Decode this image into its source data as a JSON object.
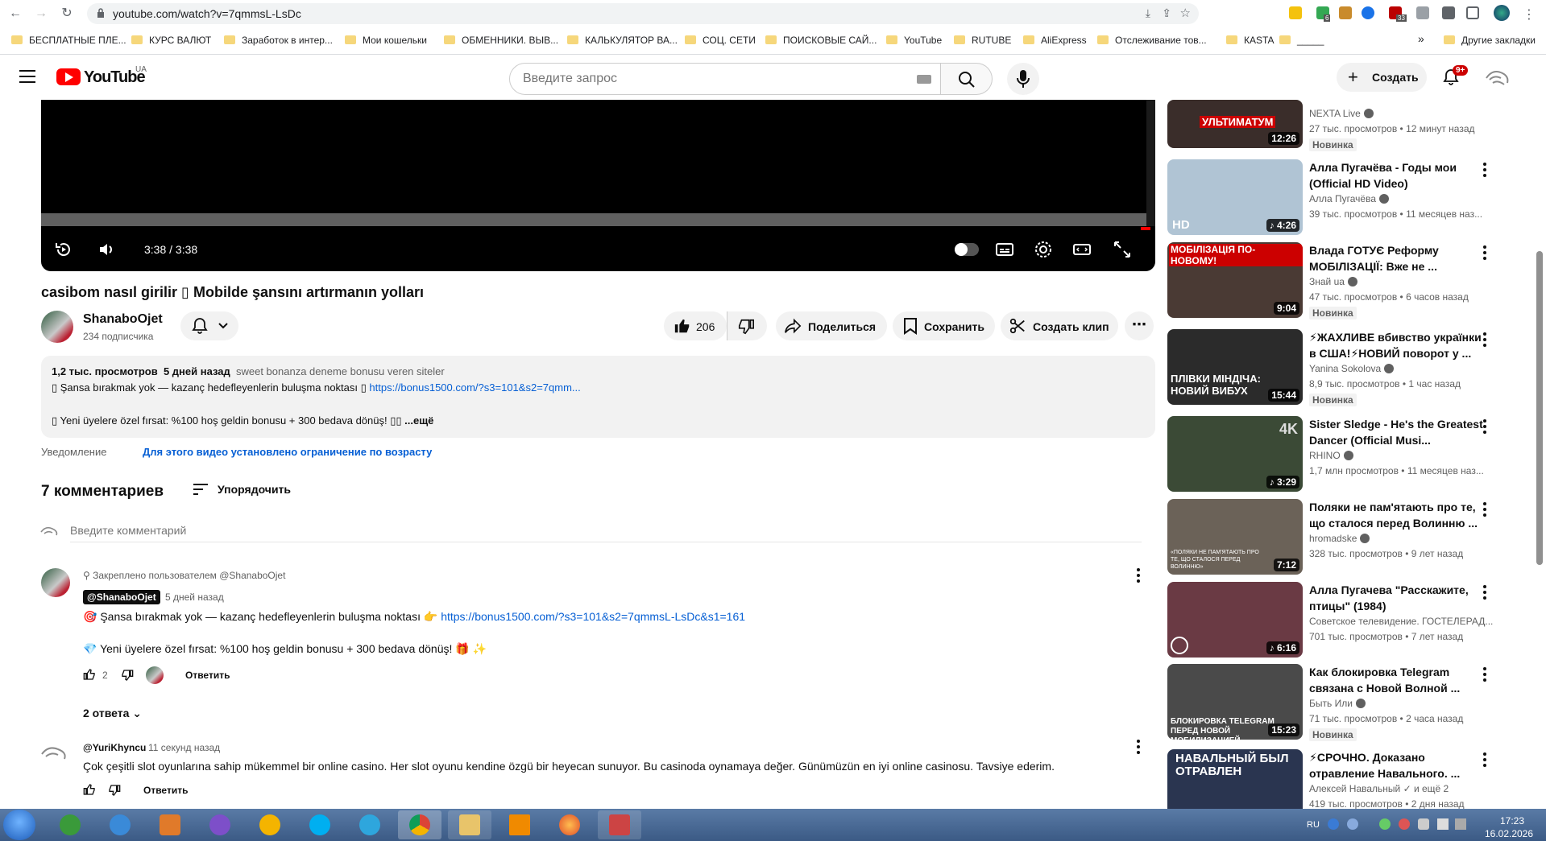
{
  "browser": {
    "url": "youtube.com/watch?v=7qmmsL-LsDc",
    "bookmarks": [
      "БЕСПЛАТНЫЕ ПЛЕ...",
      "КУРС ВАЛЮТ",
      "Заработок в интер...",
      "Мои кошельки",
      "ОБМЕННИКИ. ВЫВ...",
      "КАЛЬКУЛЯТОР ВА...",
      "СОЦ. СЕТИ",
      "ПОИСКОВЫЕ САЙ...",
      "YouTube",
      "RUTUBE",
      "AliExpress",
      "Отслеживание тов...",
      "КАSTA",
      "_____"
    ],
    "more_bookmarks": "»",
    "other_bookmarks": "Другие закладки",
    "ext_badge_1": "6",
    "ext_badge_2": "33"
  },
  "header": {
    "logo_text": "YouTube",
    "country": "UA",
    "search_placeholder": "Введите запрос",
    "create_label": "Создать",
    "notif_count": "9+"
  },
  "player": {
    "time": "3:38 / 3:38",
    "progress": 0.992
  },
  "video": {
    "title": "casibom nasıl girilir ▯ Mobilde şansını artırmanın yolları",
    "channel": "ShanaboOjet",
    "subscribers": "234 подписчика",
    "likes": "206",
    "share": "Поделиться",
    "save": "Сохранить",
    "clip": "Создать клип"
  },
  "description": {
    "views": "1,2 тыс. просмотров",
    "date": "5 дней назад",
    "tag": "sweet bonanza deneme bonusu veren siteler",
    "line1_text": "▯ Şansa bırakmak yok — kazanç hedefleyenlerin buluşma noktası ▯ ",
    "line1_link": "https://bonus1500.com/?s3=101&s2=7qmm...",
    "line2_text": "▯ Yeni üyelere özel fırsat: %100 hoş geldin bonusu + 300 bedava dönüş! ▯▯ ",
    "more": "...ещё"
  },
  "notice": {
    "label": "Уведомление",
    "text": "Для этого видео установлено ограничение по возрасту"
  },
  "comments": {
    "count": "7 комментариев",
    "sort": "Упорядочить",
    "placeholder": "Введите комментарий",
    "items": [
      {
        "pinned": "Закреплено пользователем @ShanaboOjet",
        "author": "@ShanaboOjet",
        "time": "5 дней назад",
        "text1": "🎯 Şansa bırakmak yok — kazanç hedefleyenlerin buluşma noktası 👉 ",
        "link": "https://bonus1500.com/?s3=101&s2=7qmmsL-LsDc&s1=161",
        "text2": "💎 Yeni üyelere özel fırsat: %100 hoş geldin bonusu + 300 bedava dönüş! 🎁 ✨",
        "likes": "2",
        "reply": "Ответить",
        "replies": "2 ответа"
      },
      {
        "author": "@YuriKhyncu",
        "time": "11 секунд назад",
        "text": "Çok çeşitli slot oyunlarına sahip mükemmel bir online casino. Her slot oyunu kendine özgü bir heyecan sunuyor. Bu casinoda oynamaya değer. Günümüzün en iyi online casinosu. Tavsiye ederim.",
        "reply": "Ответить"
      }
    ]
  },
  "sidebar": [
    {
      "title": "",
      "channel": "NEXTA Live",
      "meta": "27 тыс. просмотров • 12 минут назад",
      "badge": "Новинка",
      "duration": "12:26",
      "thumb_text": "УЛЬТИМАТУМ",
      "color": "#3a2d2a"
    },
    {
      "title": "Алла Пугачёва - Годы мои (Official HD Video)",
      "channel": "Алла Пугачёва",
      "meta": "39 тыс. просмотров • 11 месяцев наз...",
      "badge": "",
      "duration": "♪ 4:26",
      "thumb_text": "HD",
      "color": "#b0c4d4"
    },
    {
      "title": "Влада ГОТУЄ Реформу МОБІЛІЗАЦІЇ: Вже не ...",
      "channel": "Знай ua",
      "meta": "47 тыс. просмотров • 6 часов назад",
      "badge": "Новинка",
      "duration": "9:04",
      "thumb_text": "МОБІЛІЗАЦІЯ ПО-НОВОМУ!",
      "color": "#4a3a34"
    },
    {
      "title": "⚡ЖАХЛИВЕ вбивство українки в США!⚡НОВИЙ поворот у ...",
      "channel": "Yanina Sokolova",
      "meta": "8,9 тыс. просмотров • 1 час назад",
      "badge": "Новинка",
      "duration": "15:44",
      "thumb_text": "ПЛІВКИ МІНДІЧА: НОВИЙ ВИБУХ",
      "color": "#2b2b2b"
    },
    {
      "title": "Sister Sledge - He's the Greatest Dancer (Official Musi...",
      "channel": "RHINO",
      "meta": "1,7 млн просмотров • 11 месяцев наз...",
      "badge": "",
      "duration": "♪ 3:29",
      "thumb_text": "4K",
      "color": "#3b4a36"
    },
    {
      "title": "Поляки не пам'ятають про те, що сталося перед Волинню ...",
      "channel": "hromadske",
      "meta": "328 тыс. просмотров • 9 лет назад",
      "badge": "",
      "duration": "7:12",
      "thumb_text": "«ПОЛЯКИ НЕ ПАМ'ЯТАЮТЬ ПРО ТЕ, ЩО СТАЛОСЯ ПЕРЕД ВОЛИННЮ»",
      "color": "#6b6258"
    },
    {
      "title": "Алла Пугачева \"Расскажите, птицы\" (1984)",
      "channel": "Советское телевидение. ГОСТЕЛЕРАД...",
      "meta": "701 тыс. просмотров • 7 лет назад",
      "badge": "",
      "duration": "♪ 6:16",
      "thumb_text": "",
      "color": "#6a3a44"
    },
    {
      "title": "Как блокировка Telegram связана с Новой Волной ...",
      "channel": "Быть Или",
      "meta": "71 тыс. просмотров • 2 часа назад",
      "badge": "Новинка",
      "duration": "15:23",
      "thumb_text": "БЛОКИРОВКА TELEGRAM ПЕРЕД НОВОЙ МОБИЛИЗАЦИЕЙ",
      "color": "#4a4a4a"
    },
    {
      "title": "⚡СРОЧНО. Доказано отравление Навального. ...",
      "channel": "Алексей Навальный ✓ и ещё 2",
      "meta": "419 тыс. просмотров • 2 дня назад",
      "badge": "",
      "duration": "",
      "thumb_text": "НАВАЛЬНЫЙ БЫЛ ОТРАВЛЕН",
      "color": "#2a3550"
    }
  ],
  "taskbar": {
    "lang": "RU",
    "time": "17:23",
    "date": "16.02.2026"
  }
}
